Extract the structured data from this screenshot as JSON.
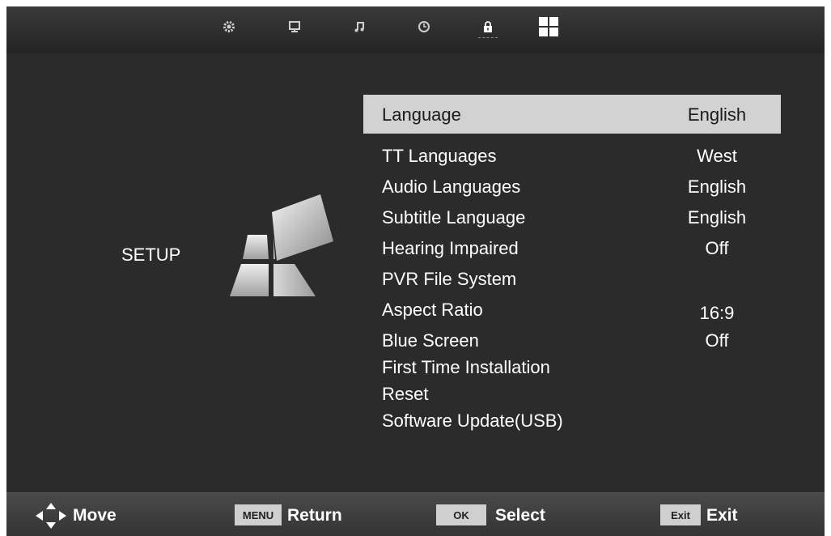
{
  "menu": {
    "section_label": "SETUP",
    "items": [
      {
        "label": "Language",
        "value": "English"
      },
      {
        "label": "TT Languages",
        "value": "West"
      },
      {
        "label": "Audio Languages",
        "value": "English"
      },
      {
        "label": "Subtitle Language",
        "value": "English"
      },
      {
        "label": "Hearing Impaired",
        "value": "Off"
      },
      {
        "label": "PVR File System",
        "value": ""
      },
      {
        "label": "Aspect Ratio",
        "value": "16:9"
      },
      {
        "label": "Blue Screen",
        "value": "Off"
      },
      {
        "label": "First Time Installation",
        "value": ""
      },
      {
        "label": "Reset",
        "value": ""
      },
      {
        "label": "Software Update(USB)",
        "value": ""
      }
    ]
  },
  "top_tabs": [
    "gear-icon",
    "monitor-icon",
    "music-note-icon",
    "clock-icon",
    "lock-icon",
    "grid-icon"
  ],
  "footer": {
    "move_label": "Move",
    "menu_key": "MENU",
    "return_label": "Return",
    "ok_key": "OK",
    "select_label": "Select",
    "exit_key": "Exit",
    "exit_label": "Exit"
  },
  "colors": {
    "background": "#2b2b2b",
    "highlight": "#d2d2d2",
    "text": "#ffffff"
  }
}
